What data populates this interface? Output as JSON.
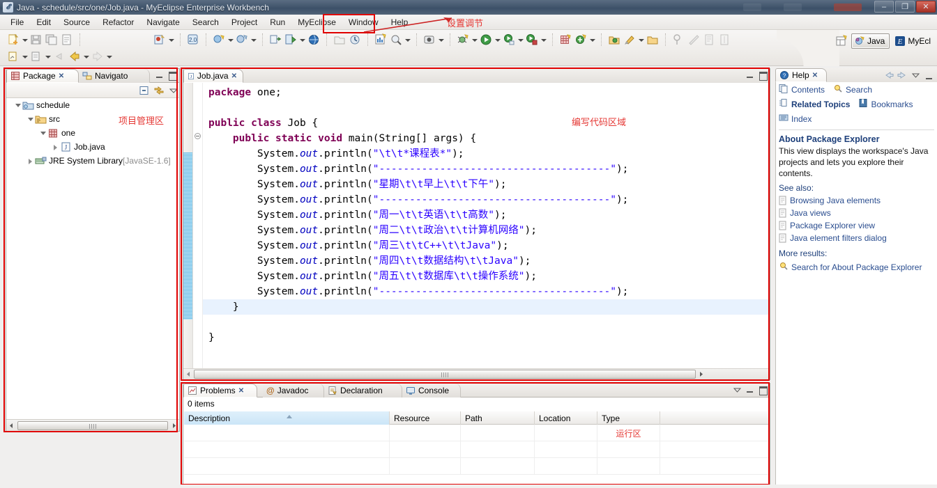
{
  "window": {
    "title": "Java - schedule/src/one/Job.java - MyEclipse Enterprise Workbench",
    "app_icon": "myeclipse-icon",
    "minimize_label": "–",
    "maximize_label": "❐",
    "close_label": "✕"
  },
  "menubar": {
    "items": [
      {
        "label": "File",
        "name": "menu-file"
      },
      {
        "label": "Edit",
        "name": "menu-edit"
      },
      {
        "label": "Source",
        "name": "menu-source"
      },
      {
        "label": "Refactor",
        "name": "menu-refactor"
      },
      {
        "label": "Navigate",
        "name": "menu-navigate"
      },
      {
        "label": "Search",
        "name": "menu-search"
      },
      {
        "label": "Project",
        "name": "menu-project"
      },
      {
        "label": "Run",
        "name": "menu-run"
      },
      {
        "label": "MyEclipse",
        "name": "menu-myeclipse"
      },
      {
        "label": "Window",
        "name": "menu-window"
      },
      {
        "label": "Help",
        "name": "menu-help"
      }
    ]
  },
  "perspective": {
    "open_icon": "open-perspective-icon",
    "items": [
      {
        "label": "Java",
        "active": true
      },
      {
        "label": "MyEcl",
        "active": false
      }
    ]
  },
  "package_explorer": {
    "tabs": [
      {
        "label": "Package",
        "active": true,
        "icon": "package-explorer-icon",
        "close": "✕"
      },
      {
        "label": "Navigato",
        "active": false,
        "icon": "navigator-icon"
      }
    ],
    "toolbar_icons": [
      "collapse-all-icon",
      "link-with-editor-icon",
      "view-menu-icon"
    ],
    "tree": [
      {
        "label": "schedule",
        "depth": 0,
        "twisty": "open",
        "icon": "java-project-icon",
        "suffix": ""
      },
      {
        "label": "src",
        "depth": 1,
        "twisty": "open",
        "icon": "source-folder-icon",
        "suffix": ""
      },
      {
        "label": "one",
        "depth": 2,
        "twisty": "open",
        "icon": "package-icon",
        "suffix": ""
      },
      {
        "label": "Job.java",
        "depth": 3,
        "twisty": "closed",
        "icon": "java-file-icon",
        "suffix": ""
      },
      {
        "label": "JRE System Library",
        "depth": 1,
        "twisty": "closed",
        "icon": "jre-library-icon",
        "suffix": " [JavaSE-1.6]"
      }
    ]
  },
  "editor": {
    "tab": {
      "label": "Job.java",
      "icon": "java-file-icon",
      "close": "✕",
      "active": true
    },
    "minimize_icon": "minimize-icon",
    "maximize_icon": "maximize-icon",
    "code_lines": [
      [
        {
          "t": "package ",
          "c": "kw"
        },
        {
          "t": "one;",
          "c": "plain"
        }
      ],
      [],
      [
        {
          "t": "public class ",
          "c": "kw"
        },
        {
          "t": "Job {",
          "c": "plain"
        }
      ],
      [
        {
          "t": "    ",
          "c": "plain"
        },
        {
          "t": "public static void ",
          "c": "kw"
        },
        {
          "t": "main(String[] args) {",
          "c": "plain"
        }
      ],
      [
        {
          "t": "        System.",
          "c": "plain"
        },
        {
          "t": "out",
          "c": "fld"
        },
        {
          "t": ".println(",
          "c": "plain"
        },
        {
          "t": "\"\\t\\t*课程表*\"",
          "c": "str"
        },
        {
          "t": ");",
          "c": "plain"
        }
      ],
      [
        {
          "t": "        System.",
          "c": "plain"
        },
        {
          "t": "out",
          "c": "fld"
        },
        {
          "t": ".println(",
          "c": "plain"
        },
        {
          "t": "\"--------------------------------------\"",
          "c": "str"
        },
        {
          "t": ");",
          "c": "plain"
        }
      ],
      [
        {
          "t": "        System.",
          "c": "plain"
        },
        {
          "t": "out",
          "c": "fld"
        },
        {
          "t": ".println(",
          "c": "plain"
        },
        {
          "t": "\"星期\\t\\t早上\\t\\t下午\"",
          "c": "str"
        },
        {
          "t": ");",
          "c": "plain"
        }
      ],
      [
        {
          "t": "        System.",
          "c": "plain"
        },
        {
          "t": "out",
          "c": "fld"
        },
        {
          "t": ".println(",
          "c": "plain"
        },
        {
          "t": "\"--------------------------------------\"",
          "c": "str"
        },
        {
          "t": ");",
          "c": "plain"
        }
      ],
      [
        {
          "t": "        System.",
          "c": "plain"
        },
        {
          "t": "out",
          "c": "fld"
        },
        {
          "t": ".println(",
          "c": "plain"
        },
        {
          "t": "\"周一\\t\\t英语\\t\\t高数\"",
          "c": "str"
        },
        {
          "t": ");",
          "c": "plain"
        }
      ],
      [
        {
          "t": "        System.",
          "c": "plain"
        },
        {
          "t": "out",
          "c": "fld"
        },
        {
          "t": ".println(",
          "c": "plain"
        },
        {
          "t": "\"周二\\t\\t政治\\t\\t计算机网络\"",
          "c": "str"
        },
        {
          "t": ");",
          "c": "plain"
        }
      ],
      [
        {
          "t": "        System.",
          "c": "plain"
        },
        {
          "t": "out",
          "c": "fld"
        },
        {
          "t": ".println(",
          "c": "plain"
        },
        {
          "t": "\"周三\\t\\tC++\\t\\tJava\"",
          "c": "str"
        },
        {
          "t": ");",
          "c": "plain"
        }
      ],
      [
        {
          "t": "        System.",
          "c": "plain"
        },
        {
          "t": "out",
          "c": "fld"
        },
        {
          "t": ".println(",
          "c": "plain"
        },
        {
          "t": "\"周四\\t\\t数据结构\\t\\tJava\"",
          "c": "str"
        },
        {
          "t": ");",
          "c": "plain"
        }
      ],
      [
        {
          "t": "        System.",
          "c": "plain"
        },
        {
          "t": "out",
          "c": "fld"
        },
        {
          "t": ".println(",
          "c": "plain"
        },
        {
          "t": "\"周五\\t\\t数据库\\t\\t操作系统\"",
          "c": "str"
        },
        {
          "t": ");",
          "c": "plain"
        }
      ],
      [
        {
          "t": "        System.",
          "c": "plain"
        },
        {
          "t": "out",
          "c": "fld"
        },
        {
          "t": ".println(",
          "c": "plain"
        },
        {
          "t": "\"--------------------------------------\"",
          "c": "str"
        },
        {
          "t": ");",
          "c": "plain"
        }
      ],
      [
        {
          "t": "    }",
          "c": "plain"
        }
      ],
      [],
      [
        {
          "t": "}",
          "c": "plain"
        }
      ]
    ]
  },
  "problems": {
    "tabs": [
      {
        "label": "Problems",
        "active": true,
        "icon": "problems-icon",
        "close": "✕"
      },
      {
        "label": "Javadoc",
        "active": false,
        "icon": "javadoc-icon"
      },
      {
        "label": "Declaration",
        "active": false,
        "icon": "declaration-icon"
      },
      {
        "label": "Console",
        "active": false,
        "icon": "console-icon"
      }
    ],
    "item_count": "0 items",
    "columns": [
      "Description",
      "Resource",
      "Path",
      "Location",
      "Type"
    ],
    "rows": []
  },
  "help": {
    "tab": {
      "label": "Help",
      "icon": "help-icon",
      "close": "✕"
    },
    "nav_icons": [
      "back-icon",
      "forward-icon",
      "view-menu-icon",
      "minimize-icon"
    ],
    "links_row1": [
      {
        "label": "Contents",
        "icon": "contents-icon",
        "bold": false
      },
      {
        "label": "Search",
        "icon": "search-icon",
        "bold": false
      }
    ],
    "links_row2": [
      {
        "label": "Related Topics",
        "icon": "related-topics-icon",
        "bold": true
      },
      {
        "label": "Bookmarks",
        "icon": "bookmarks-icon",
        "bold": false
      }
    ],
    "links_row3": [
      {
        "label": "Index",
        "icon": "index-icon",
        "bold": false
      }
    ],
    "article_title": "About Package Explorer",
    "article_body": "This view displays the workspace's Java projects and lets you explore their contents.",
    "see_also_label": "See also:",
    "see_also": [
      "Browsing Java elements",
      "Java views",
      "Package Explorer view",
      "Java element filters dialog"
    ],
    "more_results_label": "More results:",
    "more_results": [
      {
        "label": "Search for About Package Explorer",
        "icon": "search-icon"
      }
    ]
  },
  "annotations": [
    {
      "text": "设置调节",
      "name": "annotation-settings-adjust"
    },
    {
      "text": "项目管理区",
      "name": "annotation-project-area"
    },
    {
      "text": "编写代码区域",
      "name": "annotation-code-area"
    },
    {
      "text": "运行区",
      "name": "annotation-run-area"
    }
  ],
  "colors": {
    "annotation_red": "#e53935",
    "box_red": "#e00000",
    "keyword": "#7f0055",
    "string": "#2a00ff",
    "field": "#0000c0",
    "link": "#2a4d8f",
    "titlebar": "#43576e"
  }
}
